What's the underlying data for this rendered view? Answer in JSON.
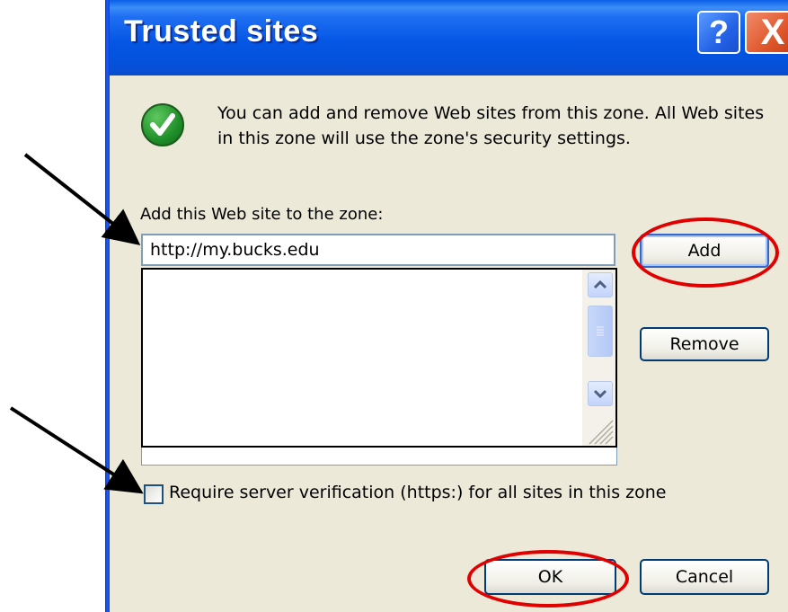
{
  "window": {
    "title": "Trusted sites",
    "help_glyph": "?",
    "close_glyph": "X"
  },
  "info": {
    "icon": "check-icon",
    "text": "You can add and remove Web sites from this zone. All Web sites in this zone will use the zone's security settings."
  },
  "add_section": {
    "label": "Add this Web site to the zone:",
    "url_value": "http://my.bucks.edu",
    "add_label": "Add",
    "remove_label": "Remove"
  },
  "websites_list": [],
  "require_https": {
    "label": "Require server verification (https:) for all sites in this zone",
    "checked": false
  },
  "footer": {
    "ok_label": "OK",
    "cancel_label": "Cancel"
  },
  "annotations": {
    "highlight_color": "#e00000",
    "arrow_color": "#000000"
  }
}
